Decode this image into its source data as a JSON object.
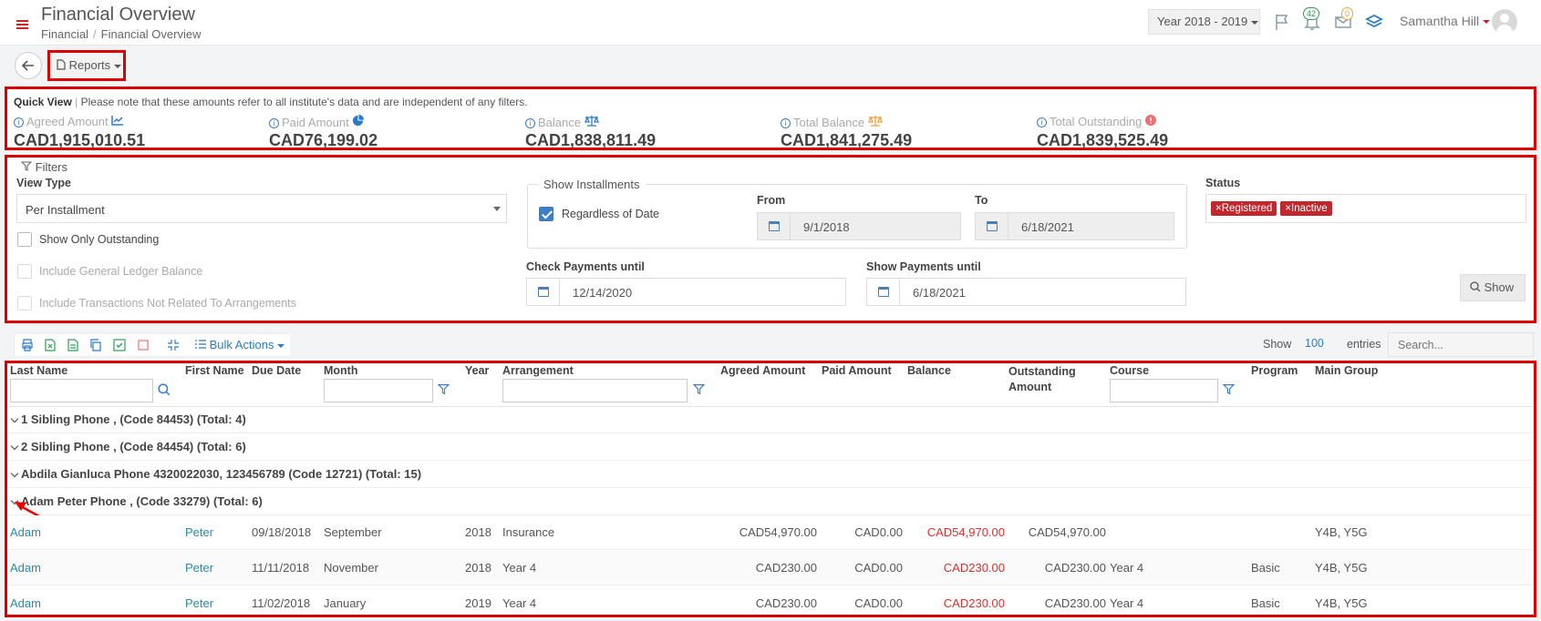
{
  "header": {
    "title": "Financial Overview",
    "breadcrumb": [
      "Financial",
      "/",
      "Financial Overview"
    ],
    "year_selector": "Year 2018 - 2019",
    "notifications_count": "42",
    "messages_count": "0",
    "user_name": "Samantha Hill"
  },
  "toolbar": {
    "reports_label": "Reports"
  },
  "quick_view": {
    "title": "Quick View",
    "note": "Please note that these amounts refer to all institute's data and are independent of any filters.",
    "items": [
      {
        "label": "Agreed Amount",
        "value": "CAD1,915,010.51",
        "icon": "chart-line-icon"
      },
      {
        "label": "Paid Amount",
        "value": "CAD76,199.02",
        "icon": "pie-chart-icon"
      },
      {
        "label": "Balance",
        "value": "CAD1,838,811.49",
        "icon": "scale-icon"
      },
      {
        "label": "Total Balance",
        "value": "CAD1,841,275.49",
        "icon": "scale-orange-icon"
      },
      {
        "label": "Total Outstanding",
        "value": "CAD1,839,525.49",
        "icon": "alert-icon"
      }
    ]
  },
  "filters": {
    "title": "Filters",
    "view_type_label": "View Type",
    "view_type_value": "Per Installment",
    "show_only_outstanding": "Show Only Outstanding",
    "include_gl": "Include General Ledger Balance",
    "include_transactions": "Include Transactions Not Related To Arrangements",
    "show_installments": "Show Installments",
    "regardless_of_date": "Regardless of Date",
    "from_label": "From",
    "from_value": "9/1/2018",
    "to_label": "To",
    "to_value": "6/18/2021",
    "check_payments_label": "Check Payments until",
    "check_payments_value": "12/14/2020",
    "show_payments_label": "Show Payments until",
    "show_payments_value": "6/18/2021",
    "status_label": "Status",
    "status_tags": [
      "×Registered",
      "×Inactive"
    ],
    "show_button": "Show"
  },
  "table_tools": {
    "bulk_actions": "Bulk Actions",
    "show_label": "Show",
    "entries_value": "100",
    "entries_label": "entries",
    "search_placeholder": "Search..."
  },
  "table": {
    "columns": [
      "Last Name",
      "First Name",
      "Due Date",
      "Month",
      "Year",
      "Arrangement",
      "Agreed Amount",
      "Paid Amount",
      "Balance",
      "Outstanding Amount",
      "Course",
      "Program",
      "Main Group"
    ],
    "groups": [
      "1 Sibling Phone , (Code 84453) (Total: 4)",
      "2 Sibling Phone , (Code 84454) (Total: 6)",
      "Abdila Gianluca Phone 4320022030, 123456789 (Code 12721) (Total: 15)",
      "Adam Peter Phone , (Code 33279) (Total: 6)"
    ],
    "rows": [
      {
        "last": "Adam",
        "first": "Peter",
        "due": "09/18/2018",
        "month": "September",
        "year": "2018",
        "arrangement": "Insurance",
        "agreed": "CAD54,970.00",
        "paid": "CAD0.00",
        "balance": "CAD54,970.00",
        "outstanding": "CAD54,970.00",
        "course": "",
        "program": "",
        "group": "Y4B, Y5G"
      },
      {
        "last": "Adam",
        "first": "Peter",
        "due": "11/11/2018",
        "month": "November",
        "year": "2018",
        "arrangement": "Year 4",
        "agreed": "CAD230.00",
        "paid": "CAD0.00",
        "balance": "CAD230.00",
        "outstanding": "CAD230.00",
        "course": "Year 4",
        "program": "Basic",
        "group": "Y4B, Y5G"
      },
      {
        "last": "Adam",
        "first": "Peter",
        "due": "11/02/2018",
        "month": "January",
        "year": "2019",
        "arrangement": "Year 4",
        "agreed": "CAD230.00",
        "paid": "CAD0.00",
        "balance": "CAD230.00",
        "outstanding": "CAD230.00",
        "course": "Year 4",
        "program": "Basic",
        "group": "Y4B, Y5G"
      }
    ]
  }
}
